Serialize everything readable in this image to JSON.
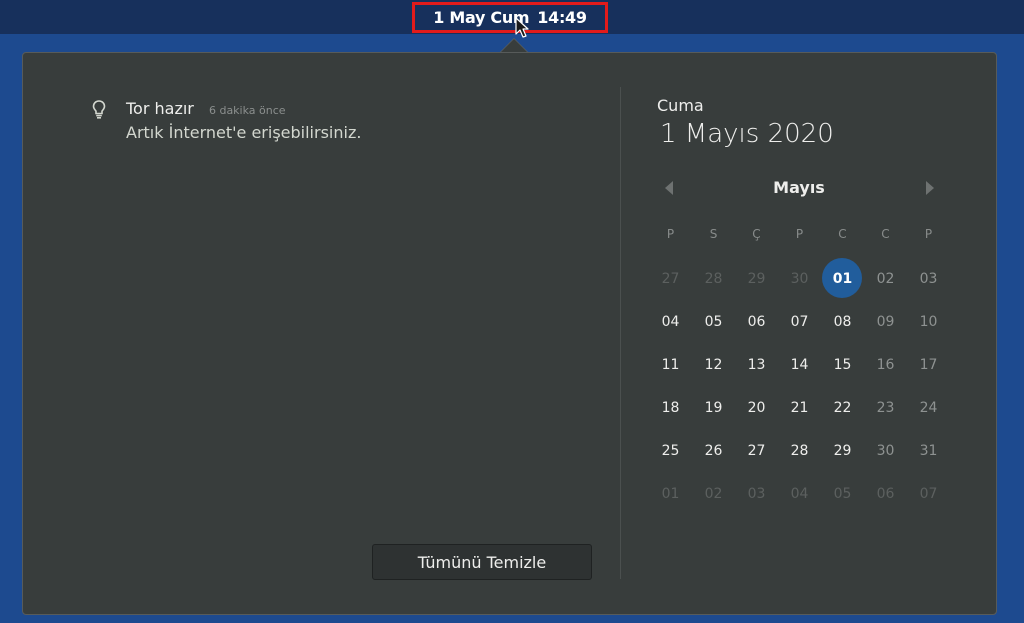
{
  "topbar": {
    "date_label": "1 May Cum",
    "time_label": "14:49"
  },
  "notification": {
    "icon": "lightbulb-icon",
    "title": "Tor hazır",
    "time": "6 dakika önce",
    "body": "Artık İnternet'e erişebilirsiniz."
  },
  "clear_button_label": "Tümünü Temizle",
  "calendar": {
    "weekday": "Cuma",
    "full_date": "1 Mayıs 2020",
    "month": "Mayıs",
    "weekday_headers": [
      "P",
      "S",
      "Ç",
      "P",
      "C",
      "C",
      "P"
    ],
    "weeks": [
      [
        "27",
        "28",
        "29",
        "30",
        "01",
        "02",
        "03"
      ],
      [
        "04",
        "05",
        "06",
        "07",
        "08",
        "09",
        "10"
      ],
      [
        "11",
        "12",
        "13",
        "14",
        "15",
        "16",
        "17"
      ],
      [
        "18",
        "19",
        "20",
        "21",
        "22",
        "23",
        "24"
      ],
      [
        "25",
        "26",
        "27",
        "28",
        "29",
        "30",
        "31"
      ],
      [
        "01",
        "02",
        "03",
        "04",
        "05",
        "06",
        "07"
      ]
    ],
    "today": "01"
  },
  "colors": {
    "desktop_background": "#1d4a8f",
    "topbar": "#17305c",
    "popover": "#383d3c",
    "highlight_box": "#e21b1b",
    "today_circle": "#215d9c"
  }
}
